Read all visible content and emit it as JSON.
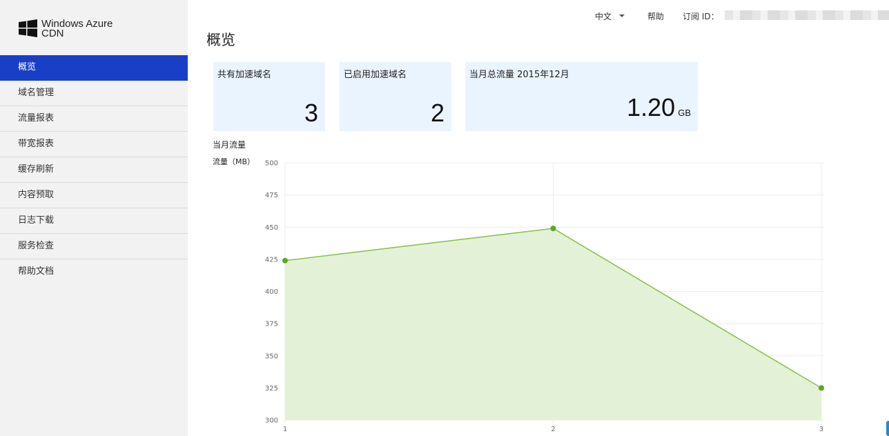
{
  "brand": {
    "line1": "Windows Azure",
    "line2": "CDN",
    "logo_icon": "windows-logo-icon"
  },
  "sidebar": {
    "items": [
      {
        "label": "概览",
        "active": true
      },
      {
        "label": "域名管理",
        "active": false
      },
      {
        "label": "流量报表",
        "active": false
      },
      {
        "label": "带宽报表",
        "active": false
      },
      {
        "label": "缓存刷新",
        "active": false
      },
      {
        "label": "内容预取",
        "active": false
      },
      {
        "label": "日志下载",
        "active": false
      },
      {
        "label": "服务检查",
        "active": false
      },
      {
        "label": "帮助文档",
        "active": false
      }
    ]
  },
  "topbar": {
    "language": "中文",
    "help": "帮助",
    "subscription_label": "订阅 ID："
  },
  "page": {
    "title": "概览"
  },
  "cards": [
    {
      "label": "共有加速域名",
      "value": "3"
    },
    {
      "label": "已启用加速域名",
      "value": "2"
    },
    {
      "label": "当月总流量 2015年12月",
      "value": "1.20",
      "unit": "GB"
    }
  ],
  "colors": {
    "accent": "#1a3fc7",
    "card_bg": "#eaf4fe",
    "line": "#8cc152",
    "fill": "#e3f2d7",
    "point": "#5ea42c"
  },
  "chart_data": {
    "type": "area",
    "title": "当月流量",
    "ylabel": "流量（MB）",
    "xlabel": "",
    "x": [
      "1",
      "2",
      "3"
    ],
    "values": [
      424,
      449,
      325
    ],
    "ylim": [
      300,
      500
    ],
    "yticks": [
      "300",
      "325",
      "350",
      "375",
      "400",
      "425",
      "450",
      "475",
      "500"
    ],
    "grid": true
  }
}
